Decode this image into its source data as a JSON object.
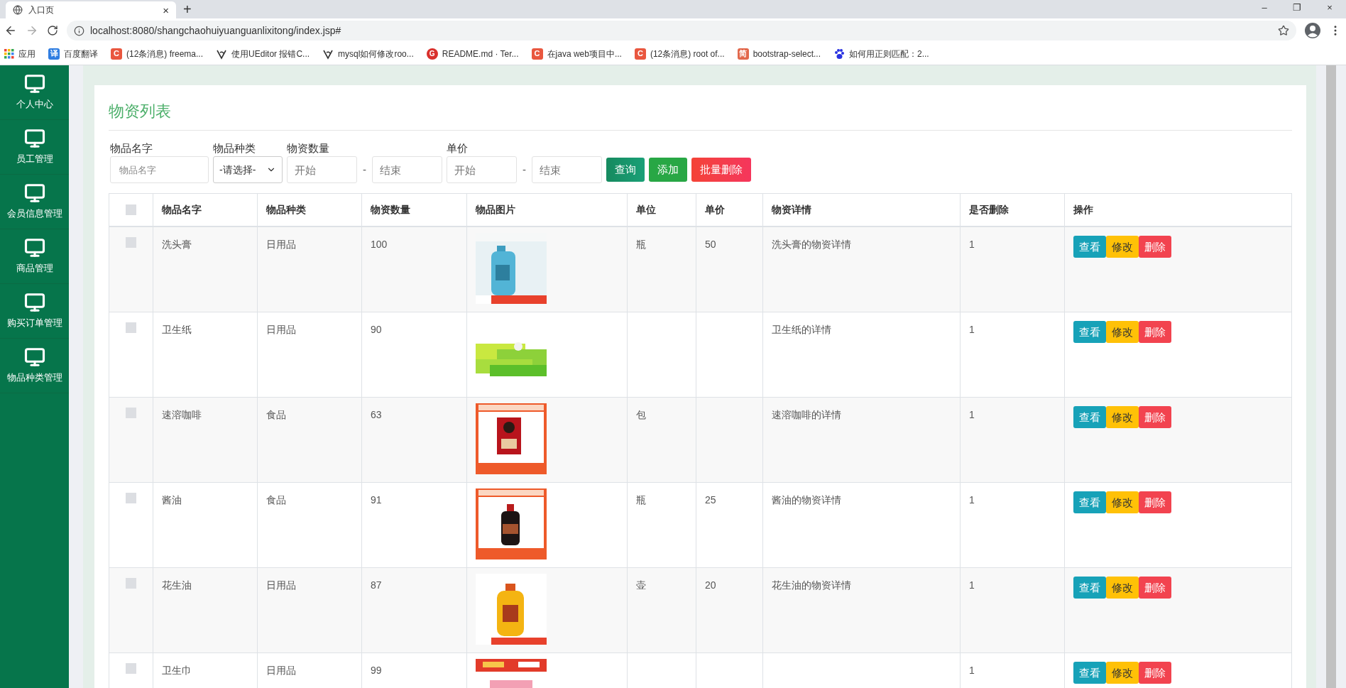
{
  "browser": {
    "tab": {
      "title": "入口页",
      "close": "×"
    },
    "new_tab": "+",
    "window_controls": [
      "–",
      "❐",
      "×"
    ],
    "url": "localhost:8080/shangchaohuiyuanguanlixitong/index.jsp#",
    "bookmarks": [
      {
        "kind": "apps",
        "label": "应用"
      },
      {
        "kind": "letter",
        "icon_text": "译",
        "color": "#2f7de1",
        "label": "百度翻译"
      },
      {
        "kind": "letter",
        "icon_text": "C",
        "color": "#e9573f",
        "label": "(12条消息) freema..."
      },
      {
        "kind": "mark",
        "label": "使用UEditor 报错C..."
      },
      {
        "kind": "mark",
        "label": "mysql如何修改roo..."
      },
      {
        "kind": "round",
        "icon_text": "G",
        "color": "#d9302c",
        "label": "README.md · Ter..."
      },
      {
        "kind": "letter",
        "icon_text": "C",
        "color": "#e9573f",
        "label": "在java web项目中..."
      },
      {
        "kind": "letter",
        "icon_text": "C",
        "color": "#e9573f",
        "label": "(12条消息) root of..."
      },
      {
        "kind": "letter",
        "icon_text": "简",
        "color": "#e2684c",
        "label": "bootstrap-select..."
      },
      {
        "kind": "paw",
        "label": "如何用正则匹配：2..."
      }
    ]
  },
  "sidebar": {
    "items": [
      {
        "label": "个人中心"
      },
      {
        "label": "员工管理"
      },
      {
        "label": "会员信息管理"
      },
      {
        "label": "商品管理"
      },
      {
        "label": "购买订单管理"
      },
      {
        "label": "物品种类管理"
      }
    ]
  },
  "page": {
    "title": "物资列表",
    "filters": [
      {
        "kind": "text",
        "label": "物品名字",
        "placeholder": "物品名字"
      },
      {
        "kind": "select",
        "label": "物品种类",
        "value": "-请选择-"
      },
      {
        "kind": "range",
        "label": "物资数量",
        "separator": "-",
        "fields": [
          {
            "placeholder": "开始"
          },
          {
            "placeholder": "结束"
          }
        ]
      },
      {
        "kind": "range",
        "label": "单价",
        "separator": "-",
        "fields": [
          {
            "placeholder": "开始"
          },
          {
            "placeholder": "结束"
          }
        ]
      }
    ],
    "buttons": [
      {
        "kind": "query",
        "label": "查询"
      },
      {
        "kind": "add",
        "label": "添加"
      },
      {
        "kind": "delete",
        "label": "批量删除"
      }
    ]
  },
  "table": {
    "select_all_checked": false,
    "columns": [
      "物品名字",
      "物品种类",
      "物资数量",
      "物品图片",
      "单位",
      "单价",
      "物资详情",
      "是否删除",
      "操作"
    ],
    "rows": [
      {
        "checked": false,
        "name": "洗头膏",
        "category": "日用品",
        "quantity": "100",
        "unit": "瓶",
        "price": "50",
        "detail": "洗头膏的物资详情",
        "deleted": "1",
        "actions": [
          {
            "kind": "view",
            "label": "查看"
          },
          {
            "kind": "edit",
            "label": "修改"
          },
          {
            "kind": "delete",
            "label": "删除"
          }
        ]
      },
      {
        "checked": false,
        "name": "卫生纸",
        "category": "日用品",
        "quantity": "90",
        "detail": "卫生纸的详情",
        "deleted": "1",
        "actions": [
          {
            "kind": "view",
            "label": "查看"
          },
          {
            "kind": "edit",
            "label": "修改"
          },
          {
            "kind": "delete",
            "label": "删除"
          }
        ]
      },
      {
        "checked": false,
        "name": "速溶咖啡",
        "category": "食品",
        "quantity": "63",
        "unit": "包",
        "detail": "速溶咖啡的详情",
        "deleted": "1",
        "actions": [
          {
            "kind": "view",
            "label": "查看"
          },
          {
            "kind": "edit",
            "label": "修改"
          },
          {
            "kind": "delete",
            "label": "删除"
          }
        ]
      },
      {
        "checked": false,
        "name": "酱油",
        "category": "食品",
        "quantity": "91",
        "unit": "瓶",
        "price": "25",
        "detail": "酱油的物资详情",
        "deleted": "1",
        "actions": [
          {
            "kind": "view",
            "label": "查看"
          },
          {
            "kind": "edit",
            "label": "修改"
          },
          {
            "kind": "delete",
            "label": "删除"
          }
        ]
      },
      {
        "checked": false,
        "name": "花生油",
        "category": "日用品",
        "quantity": "87",
        "unit": "壶",
        "price": "20",
        "detail": "花生油的物资详情",
        "deleted": "1",
        "actions": [
          {
            "kind": "view",
            "label": "查看"
          },
          {
            "kind": "edit",
            "label": "修改"
          },
          {
            "kind": "delete",
            "label": "删除"
          }
        ]
      },
      {
        "checked": false,
        "name": "卫生巾",
        "category": "日用品",
        "quantity": "99",
        "deleted": "1",
        "actions": [
          {
            "kind": "view",
            "label": "查看"
          },
          {
            "kind": "edit",
            "label": "修改"
          },
          {
            "kind": "delete",
            "label": "删除"
          }
        ]
      }
    ]
  }
}
